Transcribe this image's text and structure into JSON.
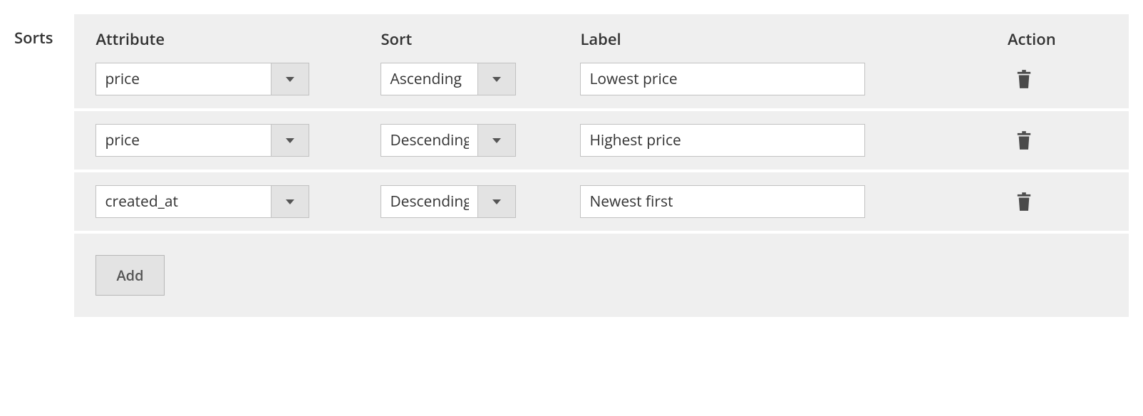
{
  "section_label": "Sorts",
  "headers": {
    "attribute": "Attribute",
    "sort": "Sort",
    "label": "Label",
    "action": "Action"
  },
  "rows": [
    {
      "attribute": "price",
      "sort": "Ascending",
      "label": "Lowest price"
    },
    {
      "attribute": "price",
      "sort": "Descending",
      "label": "Highest price"
    },
    {
      "attribute": "created_at",
      "sort": "Descending",
      "label": "Newest first"
    }
  ],
  "buttons": {
    "add": "Add"
  }
}
